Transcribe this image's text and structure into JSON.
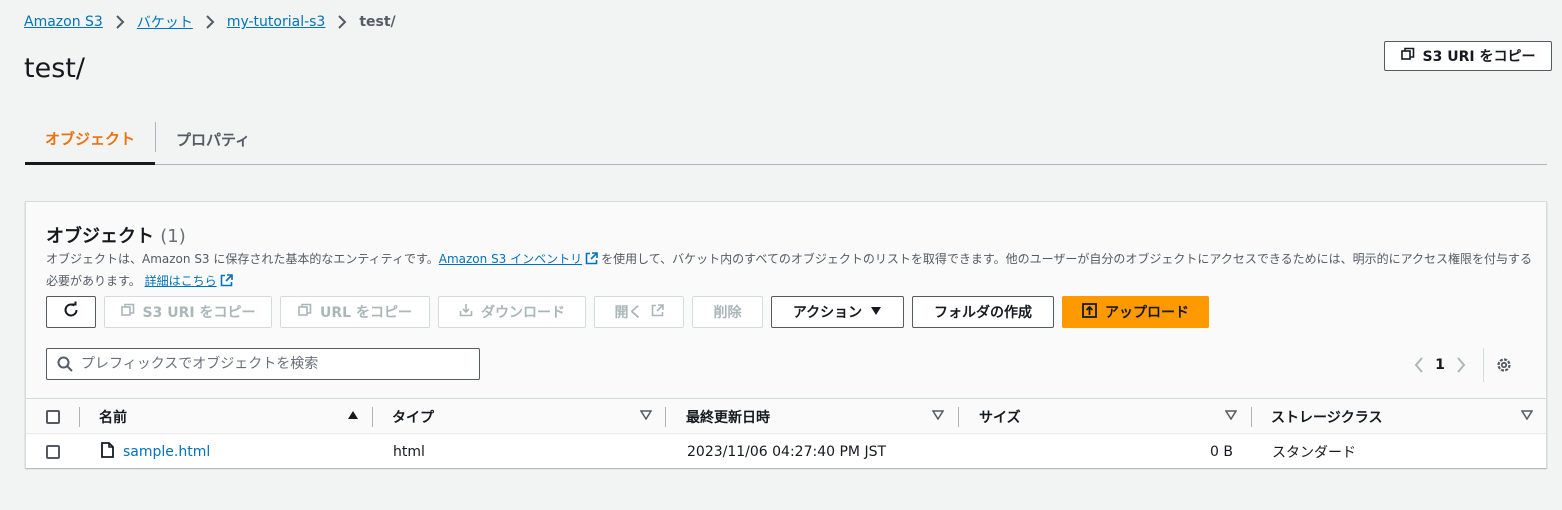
{
  "breadcrumb": {
    "items": [
      "Amazon S3",
      "バケット",
      "my-tutorial-s3"
    ],
    "current": "test/"
  },
  "page": {
    "title": "test/",
    "copy_s3_uri_label": "S3 URI をコピー"
  },
  "tabs": [
    {
      "label": "オブジェクト",
      "active": true
    },
    {
      "label": "プロパティ",
      "active": false
    }
  ],
  "objects_panel": {
    "title": "オブジェクト",
    "count": "(1)",
    "description_prefix": "オブジェクトは、Amazon S3 に保存された基本的なエンティティです。",
    "inventory_link": "Amazon S3 インベントリ",
    "description_middle": "を使用して、バケット内のすべてのオブジェクトのリストを取得できます。他のユーザーが自分のオブジェクトにアクセスできるためには、明示的にアクセス権限を付与する必要があります。",
    "learn_more_link": "詳細はこちら"
  },
  "toolbar": {
    "copy_s3_uri": "S3 URI をコピー",
    "copy_url": "URL をコピー",
    "download": "ダウンロード",
    "open": "開く",
    "delete": "削除",
    "actions": "アクション",
    "create_folder": "フォルダの作成",
    "upload": "アップロード"
  },
  "search": {
    "placeholder": "プレフィックスでオブジェクトを検索",
    "value": ""
  },
  "pagination": {
    "current_page": "1"
  },
  "table": {
    "columns": [
      "名前",
      "タイプ",
      "最終更新日時",
      "サイズ",
      "ストレージクラス"
    ],
    "rows": [
      {
        "name": "sample.html",
        "type": "html",
        "last_modified": "2023/11/06 04:27:40 PM JST",
        "size": "0 B",
        "storage_class": "スタンダード"
      }
    ]
  },
  "colors": {
    "link": "#0073bb",
    "active_tab": "#ec7211",
    "primary_button": "#ff9900",
    "background": "#f2f3f3"
  }
}
